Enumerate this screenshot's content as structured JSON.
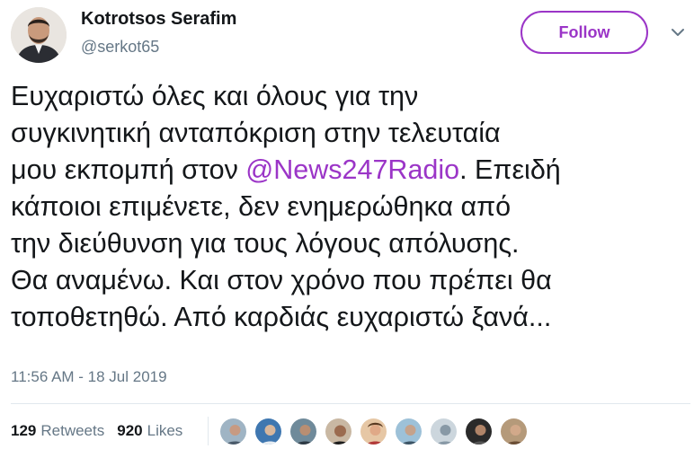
{
  "author": {
    "name": "Kotrotsos Serafim",
    "handle": "@serkot65"
  },
  "actions": {
    "follow_label": "Follow",
    "menu_icon": "chevron-down-icon"
  },
  "tweet": {
    "lines": [
      "Ευχαριστώ όλες και όλους για την",
      "συγκινητική ανταπόκριση στην τελευταία",
      "μου εκπομπή στον "
    ],
    "mention": "@News247Radio",
    "after_mention": ". Επειδή",
    "lines_rest": [
      "κάποιοι επιμένετε, δεν ενημερώθηκα από",
      "την διεύθυνση για τους λόγους απόλυσης.",
      "Θα αναμένω. Και στον χρόνο που πρέπει θα",
      "τοποθετηθώ. Από καρδιάς ευχαριστώ ξανά..."
    ]
  },
  "timestamp": "11:56 AM - 18 Jul 2019",
  "stats": {
    "retweets_count": "129",
    "retweets_label": "Retweets",
    "likes_count": "920",
    "likes_label": "Likes"
  },
  "colors": {
    "accent": "#9b35c7",
    "secondary_text": "#657786",
    "primary_text": "#14171a"
  }
}
